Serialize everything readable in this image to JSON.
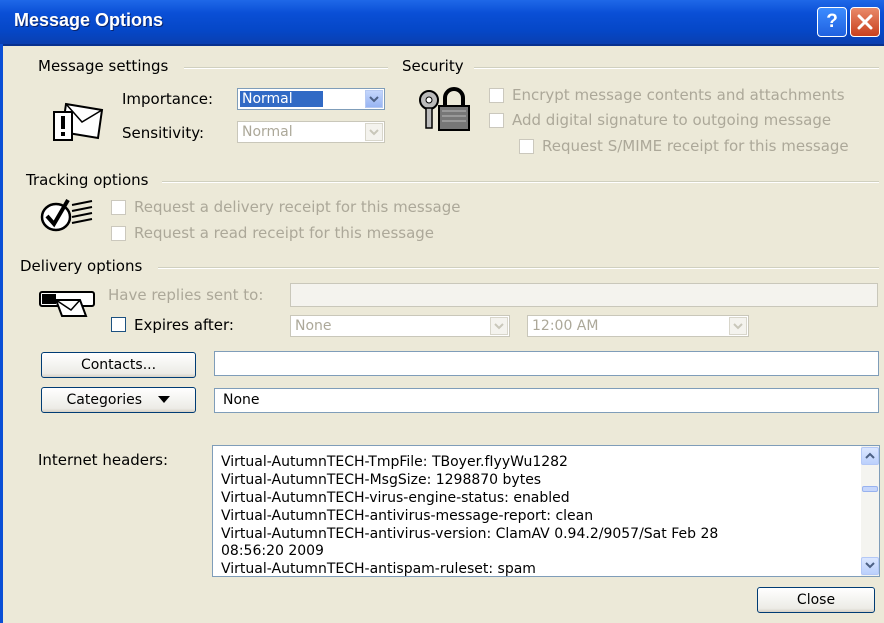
{
  "window": {
    "title": "Message Options",
    "help_glyph": "?",
    "close_glyph": "✕"
  },
  "message_settings": {
    "heading": "Message settings",
    "importance_label": "Importance:",
    "importance_value": "Normal",
    "sensitivity_label": "Sensitivity:",
    "sensitivity_value": "Normal"
  },
  "security": {
    "heading": "Security",
    "encrypt_label": "Encrypt message contents and attachments",
    "signature_label": "Add digital signature to outgoing message",
    "smime_label": "Request S/MIME receipt for this message"
  },
  "tracking": {
    "heading": "Tracking options",
    "delivery_receipt_label": "Request a delivery receipt for this message",
    "read_receipt_label": "Request a read receipt for this message"
  },
  "delivery": {
    "heading": "Delivery options",
    "replies_label": "Have replies sent to:",
    "replies_value": "",
    "expires_label": "Expires after:",
    "expires_date": "None",
    "expires_time": "12:00 AM"
  },
  "contacts": {
    "button_label": "Contacts...",
    "value": ""
  },
  "categories": {
    "button_label": "Categories",
    "value": "None"
  },
  "internet_headers": {
    "label": "Internet headers:",
    "lines": [
      "Virtual-AutumnTECH-TmpFile: TBoyer.fIyyWu1282",
      "Virtual-AutumnTECH-MsgSize: 1298870 bytes",
      "Virtual-AutumnTECH-virus-engine-status: enabled",
      "Virtual-AutumnTECH-antivirus-message-report: clean",
      "Virtual-AutumnTECH-antivirus-version: ClamAV 0.94.2/9057/Sat Feb 28",
      "08:56:20 2009",
      "Virtual-AutumnTECH-antispam-ruleset: spam"
    ]
  },
  "close_button": {
    "label": "Close"
  },
  "icons": {
    "message": "message-envelope-icon",
    "security": "keys-padlock-icon",
    "tracking": "checkmark-clipboard-icon",
    "delivery": "hand-envelope-icon"
  },
  "colors": {
    "title_bar": "#0a4fd6",
    "dialog_bg": "#ece9d8",
    "selection": "#316ac5",
    "disabled_text": "#aca899"
  }
}
